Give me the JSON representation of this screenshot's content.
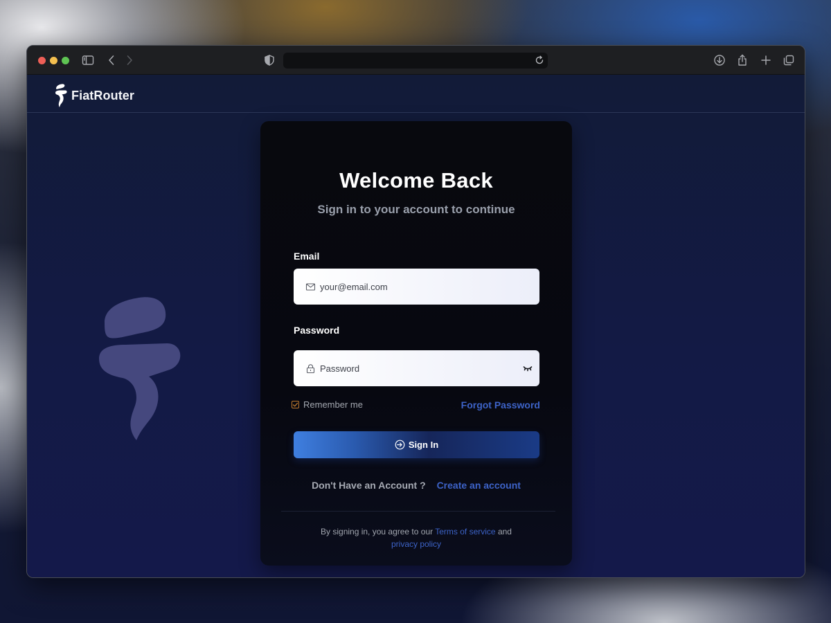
{
  "browser": {
    "url_text": ""
  },
  "brand": {
    "name": "FiatRouter"
  },
  "login": {
    "title": "Welcome Back",
    "subtitle": "Sign in to your account to continue",
    "email": {
      "label": "Email",
      "placeholder": "your@email.com",
      "value": ""
    },
    "password": {
      "label": "Password",
      "placeholder": "Password",
      "value": ""
    },
    "remember_label": "Remember me",
    "forgot_label": "Forgot Password",
    "submit_label": "Sign In",
    "no_account_text": "Don't Have an Account ?",
    "create_account_label": "Create an account",
    "terms_prefix": "By signing in, you agree to our",
    "terms_link": "Terms of service",
    "terms_and": "and",
    "privacy_link": "privacy policy"
  },
  "icons": {
    "sidebar": "sidebar-icon",
    "back": "chevron-left-icon",
    "forward": "chevron-right-icon",
    "shield": "shield-icon",
    "reload": "reload-icon",
    "download": "download-icon",
    "share": "share-icon",
    "new_tab": "plus-icon",
    "tabs": "tabs-overview-icon",
    "mail": "mail-icon",
    "lock": "lock-icon",
    "eye": "eye-closed-icon",
    "sign_in": "sign-in-icon"
  },
  "colors": {
    "accent": "#3d63c8",
    "card_bg": "#08090e",
    "page_bg": "#131a45",
    "checkbox": "#c07a2e"
  }
}
